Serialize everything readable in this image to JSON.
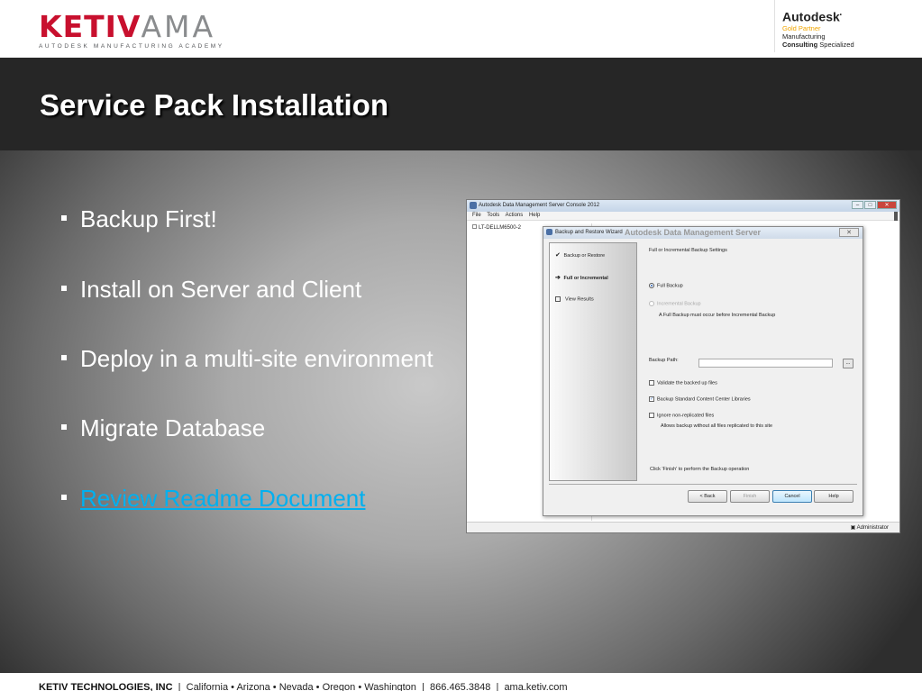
{
  "header": {
    "logo_red": "KETIV",
    "logo_gray": "AMA",
    "logo_sub": "AUTODESK MANUFACTURING ACADEMY",
    "partner": {
      "brand": "Autodesk",
      "tier": "Gold Partner",
      "line1": "Manufacturing",
      "line2_bold": "Consulting",
      "line2_rest": "Specialized"
    }
  },
  "slide": {
    "title": "Service Pack Installation",
    "bullets": [
      "Backup First!",
      "Install on Server and Client",
      "Deploy in a multi-site environment",
      "Migrate Database",
      "Review Readme Document"
    ]
  },
  "screenshot": {
    "window_title": "Autodesk Data Management Server Console 2012",
    "menu": [
      "File",
      "Tools",
      "Actions",
      "Help"
    ],
    "tree_root": "LT-DELLM6500-2",
    "status_user": "Administrator",
    "dialog": {
      "title": "Backup and Restore Wizard",
      "ghost_title": "Autodesk Data Management Server",
      "steps": [
        "Backup or Restore",
        "Full or Incremental",
        "View Results"
      ],
      "heading": "Full or Incremental Backup Settings",
      "full_backup": "Full Backup",
      "incremental_backup": "Incremental Backup",
      "note": "A Full Backup must occur before Incremental Backup",
      "backup_path_label": "Backup Path:",
      "browse_label": "...",
      "options": [
        "Validate the backed up files",
        "Backup Standard Content Center Libraries",
        "Ignore non-replicated files"
      ],
      "options_note": "Allows backup without all files replicated to this site",
      "finish_hint": "Click 'Finish' to perform the Backup operation",
      "buttons": [
        "< Back",
        "Finish",
        "Cancel",
        "Help"
      ],
      "close_glyph": "✕"
    }
  },
  "footer": {
    "company": "KETIV TECHNOLOGIES, INC",
    "locations": "California  •  Arizona  •  Nevada  •  Oregon  •  Washington",
    "phone": "866.465.3848",
    "site": "ama.ketiv.com",
    "separator": "|"
  }
}
